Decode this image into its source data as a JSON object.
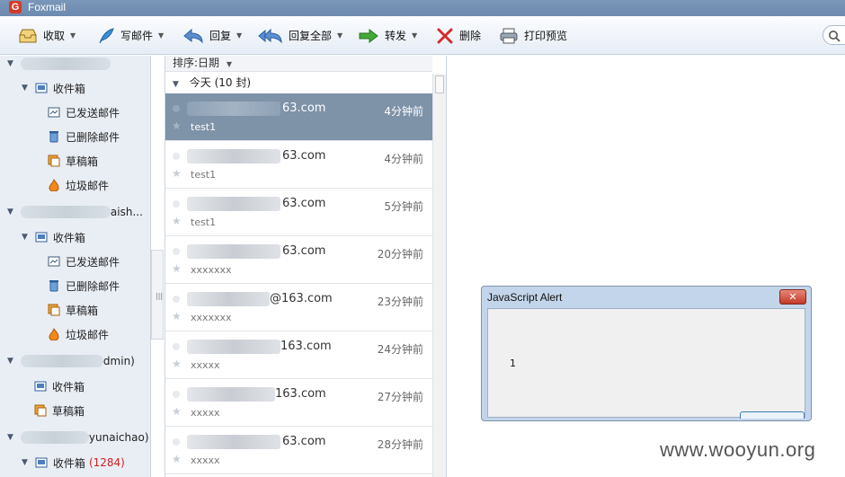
{
  "app": {
    "title": "Foxmail",
    "logo_letter": "G"
  },
  "toolbar": {
    "receive": "收取",
    "compose": "写邮件",
    "reply": "回复",
    "reply_all": "回复全部",
    "forward": "转发",
    "delete": "删除",
    "print_preview": "打印预览"
  },
  "sidebar": {
    "accounts": [
      {
        "name_suffix": "",
        "inbox": "收件箱",
        "sent": "已发送邮件",
        "deleted": "已删除邮件",
        "drafts": "草稿箱",
        "junk": "垃圾邮件"
      },
      {
        "name_suffix": "aish...",
        "inbox": "收件箱",
        "sent": "已发送邮件",
        "deleted": "已删除邮件",
        "drafts": "草稿箱",
        "junk": "垃圾邮件"
      },
      {
        "name_suffix": "dmin)",
        "inbox": "收件箱",
        "drafts": "草稿箱"
      },
      {
        "name_suffix": "yunaichao)",
        "inbox": "收件箱",
        "inbox_count": "(1284)"
      }
    ]
  },
  "list": {
    "sort_label": "排序:日期",
    "group_label": "今天 (10 封)",
    "mails": [
      {
        "sender": "63.com",
        "time": "4分钟前",
        "subject": "test1"
      },
      {
        "sender": "63.com",
        "time": "4分钟前",
        "subject": "test1"
      },
      {
        "sender": "63.com",
        "time": "5分钟前",
        "subject": "test1"
      },
      {
        "sender": "63.com",
        "time": "20分钟前",
        "subject": "xxxxxxx"
      },
      {
        "sender": "@163.com",
        "time": "23分钟前",
        "subject": "xxxxxxx"
      },
      {
        "sender": "163.com",
        "time": "24分钟前",
        "subject": "xxxxx"
      },
      {
        "sender": "163.com",
        "time": "27分钟前",
        "subject": "xxxxx"
      },
      {
        "sender": "63.com",
        "time": "28分钟前",
        "subject": "xxxxx"
      }
    ]
  },
  "alert": {
    "title": "JavaScript Alert",
    "message": "1",
    "close": "✕"
  },
  "watermark": "www.wooyun.org"
}
